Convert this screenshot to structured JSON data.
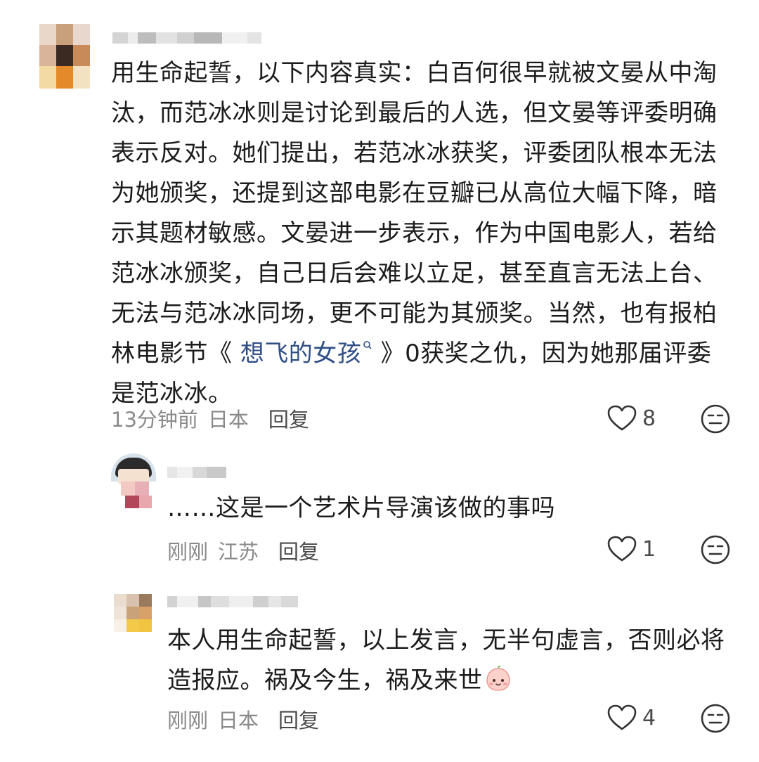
{
  "comments": [
    {
      "text_before_link": "用生命起誓，以下内容真实：白百何很早就被文晏从中淘汰，而范冰冰则是讨论到最后的人选，但文晏等评委明确表示反对。她们提出，若范冰冰获奖，评委团队根本无法为她颁奖，还提到这部电影在豆瓣已从高位大幅下降，暗示其题材敏感。文晏进一步表示，作为中国电影人，若给范冰冰颁奖，自己日后会难以立足，甚至直言无法上台、无法与范冰冰同场，更不可能为其颁奖。当然，也有报柏林电影节《 ",
      "link_text": "想飞的女孩",
      "text_after_link": " 》0获奖之仇，因为她那届评委是范冰冰。",
      "time": "13分钟前",
      "location": "日本",
      "reply_label": "回复",
      "likes": "8"
    },
    {
      "text": "……这是一个艺术片导演该做的事吗",
      "time": "刚刚",
      "location": "江苏",
      "reply_label": "回复",
      "likes": "1"
    },
    {
      "text": "本人用生命起誓，以上发言，无半句虚言，否则必将造报应。祸及今生，祸及来世",
      "time": "刚刚",
      "location": "日本",
      "reply_label": "回复",
      "likes": "4"
    }
  ],
  "icons": {
    "like": "heart-outline-icon",
    "dislike": "neutral-face-icon",
    "search": "search-icon",
    "emoji": "peach-face-emoji"
  },
  "colors": {
    "text": "#1c1c1c",
    "meta": "#8a8a8a",
    "link": "#2f4f86"
  }
}
